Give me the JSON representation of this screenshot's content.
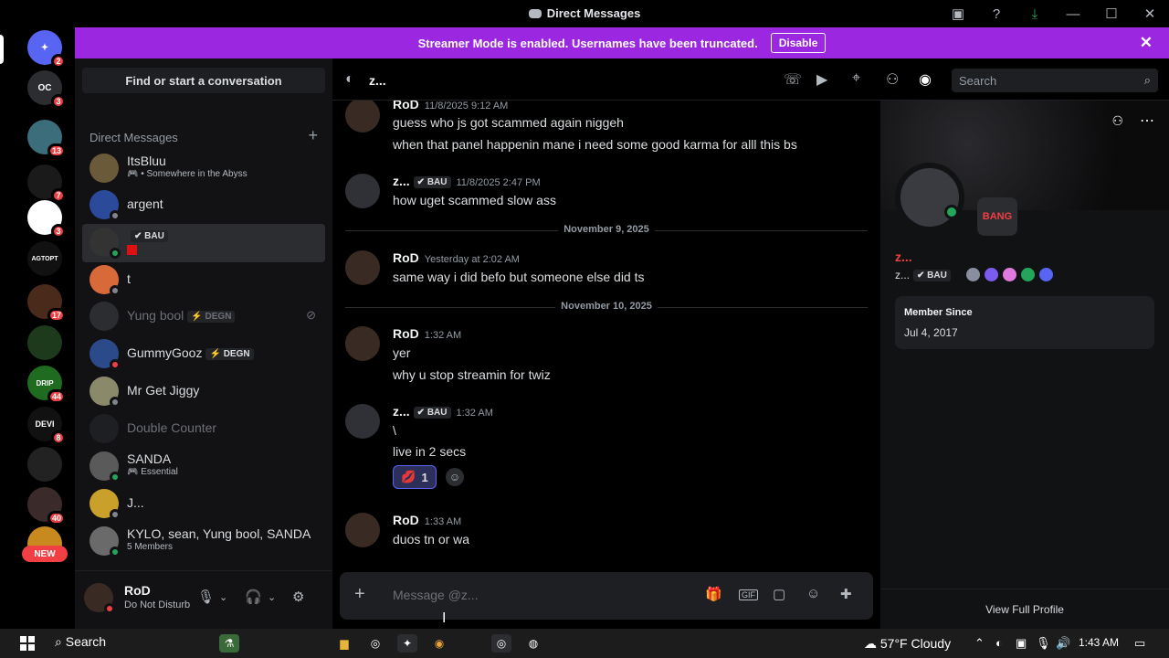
{
  "window": {
    "title": "Direct Messages"
  },
  "titlebar": {
    "icons": [
      "screen-share-icon",
      "help-icon",
      "download-icon",
      "minimize-icon",
      "maximize-icon",
      "close-icon"
    ]
  },
  "banner": {
    "text": "Streamer Mode is enabled. Usernames have been truncated.",
    "button": "Disable",
    "color": "#9b27e0"
  },
  "servers": [
    {
      "label": "",
      "badge": "2",
      "name": "discord-home"
    },
    {
      "label": "OC",
      "badge": "3"
    },
    {
      "label": "",
      "badge": "13"
    },
    {
      "label": "",
      "badge": "7"
    },
    {
      "label": "",
      "badge": "3"
    },
    {
      "label": "AGTOPT",
      "badge": ""
    },
    {
      "label": "",
      "badge": "17"
    },
    {
      "label": "",
      "badge": ""
    },
    {
      "label": "DRIP",
      "badge": "44"
    },
    {
      "label": "DEVI",
      "badge": "8"
    },
    {
      "label": "",
      "badge": ""
    },
    {
      "label": "",
      "badge": "40"
    },
    {
      "label": "",
      "badge": ""
    }
  ],
  "new_badge": "NEW",
  "sidebar": {
    "find": "Find or start a conversation",
    "header": "Direct Messages",
    "items": [
      {
        "name": "ItsBluu",
        "sub": "🎮 • Somewhere in the Abyss",
        "tag": ""
      },
      {
        "name": "argent",
        "sub": "",
        "tag": ""
      },
      {
        "name": "",
        "sub": "",
        "tag": "✔ BAU"
      },
      {
        "name": "t",
        "sub": "",
        "tag": ""
      },
      {
        "name": "Yung bool",
        "sub": "",
        "tag": "⚡ DEGN"
      },
      {
        "name": "GummyGooz",
        "sub": "",
        "tag": "⚡ DEGN"
      },
      {
        "name": "Mr Get Jiggy",
        "sub": "",
        "tag": ""
      },
      {
        "name": "Double Counter",
        "sub": "",
        "tag": ""
      },
      {
        "name": "SANDA",
        "sub": "🎮 Essential",
        "tag": ""
      },
      {
        "name": "J...",
        "sub": "",
        "tag": ""
      },
      {
        "name": "KYLO, sean, Yung bool, SANDA",
        "sub": "5 Members",
        "tag": ""
      }
    ]
  },
  "user": {
    "name": "RoD",
    "status": "Do Not Disturb"
  },
  "chat": {
    "header_name": "z...",
    "search_placeholder": "Search",
    "messages": [
      {
        "author": "RoD",
        "time": "11/8/2025 9:12 AM",
        "lines": [
          "guess who js got scammed again niggeh",
          "when that panel happenin mane i need some good karma for alll this bs"
        ]
      },
      {
        "author": "z...",
        "tag": "✔ BAU",
        "time": "11/8/2025 2:47 PM",
        "lines": [
          "how  uget scammed slow ass"
        ]
      },
      {
        "author": "RoD",
        "time": "Yesterday at 2:02 AM",
        "lines": [
          "same way i did befo but someone else did ts"
        ]
      },
      {
        "author": "RoD",
        "time": "1:32 AM",
        "lines": [
          "yer",
          "why u stop streamin for twiz"
        ]
      },
      {
        "author": "z...",
        "tag": "✔ BAU",
        "time": "1:32 AM",
        "lines": [
          "\\",
          "live in 2 secs"
        ]
      },
      {
        "author": "RoD",
        "time": "1:33 AM",
        "lines": [
          "duos tn or wa"
        ]
      }
    ],
    "dividers": [
      "November 9, 2025",
      "November 10, 2025"
    ],
    "reaction_count": "1"
  },
  "composer": {
    "placeholder": "Message @z..."
  },
  "profile": {
    "badge_text": "BANG",
    "display_name": "z...",
    "username": "z...",
    "tag": "✔ BAU",
    "member_since_label": "Member Since",
    "member_since": "Jul 4, 2017",
    "full_profile": "View Full Profile"
  },
  "taskbar": {
    "search": "Search",
    "weather": "57°F  Cloudy",
    "time": "1:43 AM"
  }
}
